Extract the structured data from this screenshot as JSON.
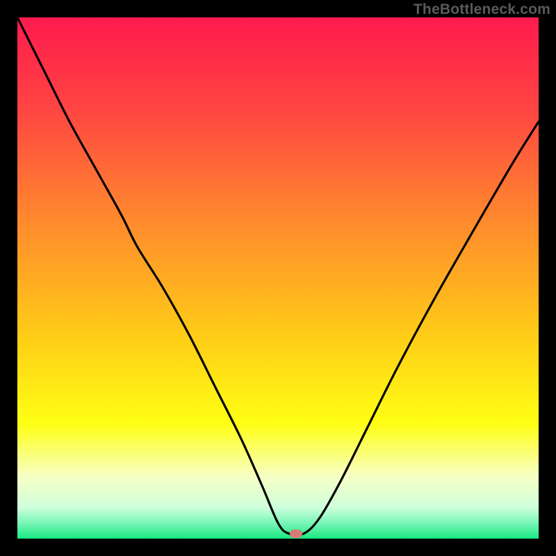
{
  "watermark": "TheBottleneck.com",
  "marker": {
    "color": "#d77b76",
    "x_pct": 53.5,
    "y_pct": 99.0
  },
  "gradient_stops": [
    {
      "pct": 0,
      "color": "#ff1a4e"
    },
    {
      "pct": 18,
      "color": "#ff4642"
    },
    {
      "pct": 40,
      "color": "#ff8d2c"
    },
    {
      "pct": 62,
      "color": "#ffcf16"
    },
    {
      "pct": 78,
      "color": "#ffff14"
    },
    {
      "pct": 88,
      "color": "#f7ffc4"
    },
    {
      "pct": 94,
      "color": "#cfffdc"
    },
    {
      "pct": 97,
      "color": "#79f6b8"
    },
    {
      "pct": 100,
      "color": "#18e880"
    }
  ],
  "chart_data": {
    "type": "line",
    "title": "",
    "xlabel": "",
    "ylabel": "",
    "xlim": [
      0,
      100
    ],
    "ylim": [
      0,
      100
    ],
    "series": [
      {
        "name": "bottleneck-curve",
        "x": [
          0,
          5,
          10,
          15,
          20,
          23,
          28,
          33,
          38,
          43,
          47,
          50,
          52,
          55,
          58,
          62,
          67,
          73,
          80,
          88,
          95,
          100
        ],
        "y": [
          100,
          90,
          80,
          71,
          62,
          56,
          48,
          39,
          29,
          19,
          10,
          3,
          1,
          1,
          4,
          11,
          21,
          33,
          46,
          60,
          72,
          80
        ]
      }
    ],
    "annotations": [
      {
        "type": "marker",
        "x": 53.5,
        "y": 1.0,
        "label": "optimal-point"
      }
    ]
  }
}
